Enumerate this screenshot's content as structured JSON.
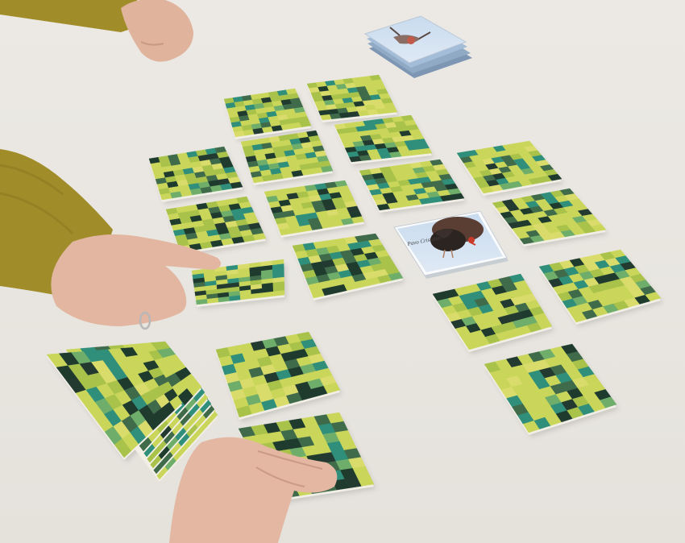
{
  "scene": {
    "subject": "memory-matching-card-game",
    "table_color": "#ebe8e3",
    "card_back_palette": [
      "#c9d65a",
      "#a9c24a",
      "#2f8f7a",
      "#3f6b4a",
      "#1e3b2e",
      "#d9dc6a",
      "#6fae6a",
      "#233a30"
    ],
    "sleeve_color": "#a8932a",
    "skin_color": "#e2b8a4"
  },
  "cards": {
    "face_up_count": 2,
    "face_down_on_table": 20,
    "face_up": [
      {
        "illustration": "turkey",
        "label": "Pavo Cristatus"
      },
      {
        "illustration": "bird-in-flight",
        "label": ""
      }
    ]
  }
}
